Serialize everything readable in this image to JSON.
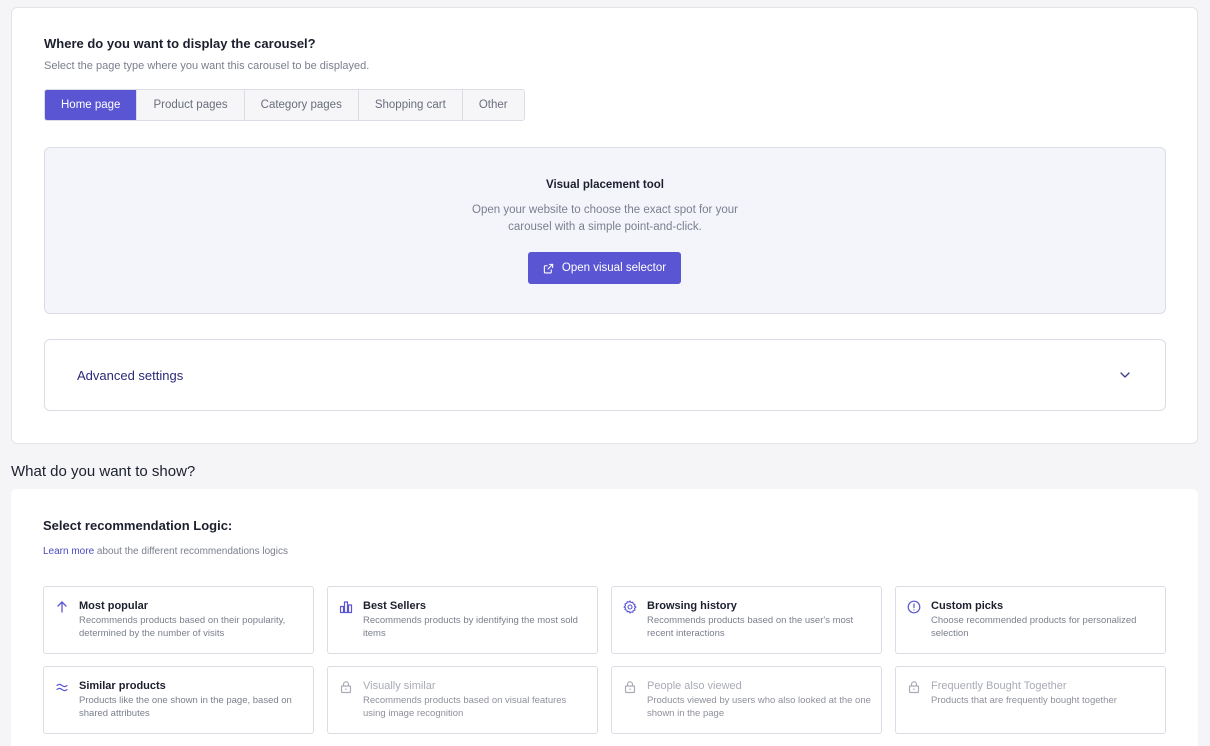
{
  "placement": {
    "title": "Where do you want to display the carousel?",
    "subtitle": "Select the page type where you want this carousel to be displayed.",
    "tabs": [
      "Home page",
      "Product pages",
      "Category pages",
      "Shopping cart",
      "Other"
    ],
    "active_tab": "Home page"
  },
  "visual_tool": {
    "title": "Visual placement tool",
    "desc_line1": "Open your website to choose the exact spot for your",
    "desc_line2": "carousel with a simple point-and-click.",
    "button_label": "Open visual selector",
    "button_icon": "external-link-icon"
  },
  "advanced": {
    "label": "Advanced settings",
    "icon": "chevron-down-icon"
  },
  "show_section": {
    "title": "What do you want to show?",
    "logic_title": "Select recommendation Logic:",
    "learn_link": "Learn more",
    "learn_rest": " about the different recommendations logics"
  },
  "logics": [
    {
      "title": "Most popular",
      "desc": "Recommends products based on their popularity, determined by the number of visits",
      "icon": "arrow-up-icon",
      "locked": false
    },
    {
      "title": "Best Sellers",
      "desc": "Recommends products by identifying the most sold items",
      "icon": "bar-chart-icon",
      "locked": false
    },
    {
      "title": "Browsing history",
      "desc": "Recommends products based on the user's most recent interactions",
      "icon": "gear-icon",
      "locked": false
    },
    {
      "title": "Custom picks",
      "desc": "Choose recommended products for personalized selection",
      "icon": "alert-circle-icon",
      "locked": false
    },
    {
      "title": "Similar products",
      "desc": "Products like the one shown in the page, based on shared attributes",
      "icon": "approx-icon",
      "locked": false
    },
    {
      "title": "Visually similar",
      "desc": "Recommends products based on visual features using image recognition",
      "icon": "lock-icon",
      "locked": true
    },
    {
      "title": "People also viewed",
      "desc": "Products viewed by users who also looked at the one shown in the page",
      "icon": "lock-icon",
      "locked": true
    },
    {
      "title": "Frequently Bought Together",
      "desc": "Products that are frequently bought together",
      "icon": "lock-icon",
      "locked": true
    }
  ],
  "colors": {
    "accent": "#5a55d2",
    "link": "#4a4ac2",
    "background": "#f5f5f8"
  }
}
